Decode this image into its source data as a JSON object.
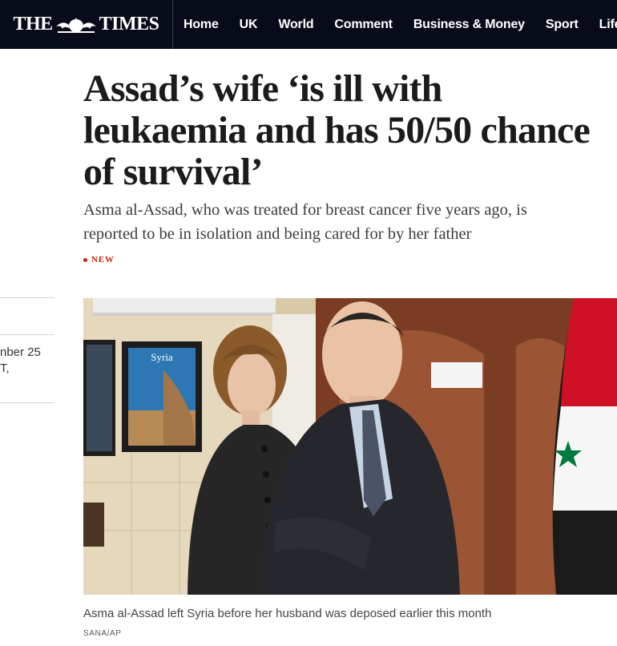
{
  "nav": {
    "logo_left": "THE",
    "logo_right": "TIMES",
    "items": [
      "Home",
      "UK",
      "World",
      "Comment",
      "Business & Money",
      "Sport",
      "Life"
    ]
  },
  "sidebar": {
    "date_line1": "nber 25",
    "date_line2": "T,"
  },
  "article": {
    "headline": "Assad’s wife ‘is ill with leukaemia and has 50/50 chance of survival’",
    "standfirst": "Asma al-Assad, who was treated for breast cancer five years ago, is reported to be in isolation and being cared for by her father",
    "badge": "NEW",
    "image_caption": "Asma al-Assad left Syria before her husband was deposed earlier this month",
    "image_credit": "SANA/AP",
    "poster_text": "Syria"
  },
  "colors": {
    "nav_bg": "#080b1a",
    "badge_red": "#c4260e",
    "flag_red": "#ce1126",
    "flag_green": "#007a3d"
  },
  "icons": [
    "crest-icon",
    "bullet-dot-icon"
  ]
}
